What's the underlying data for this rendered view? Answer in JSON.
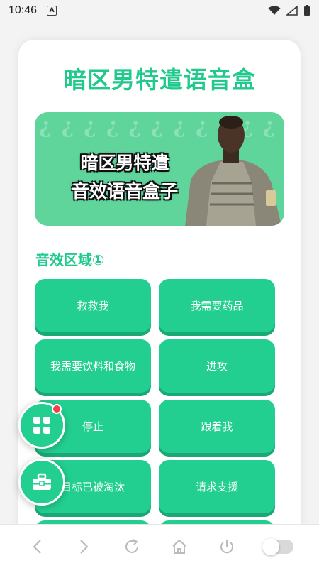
{
  "status_bar": {
    "time": "10:46",
    "notification_letter": "A"
  },
  "app": {
    "title": "暗区男特遣语音盒"
  },
  "banner": {
    "line1": "暗区男特遣",
    "line2": "音效语音盒子",
    "pattern_glyph": "¿"
  },
  "section": {
    "title": "音效区域①"
  },
  "sounds": [
    {
      "label": "救救我"
    },
    {
      "label": "我需要药品"
    },
    {
      "label": "我需要饮料和食物"
    },
    {
      "label": "进攻"
    },
    {
      "label": "停止"
    },
    {
      "label": "跟着我"
    },
    {
      "label": "目标已被淘汰"
    },
    {
      "label": "请求支援"
    },
    {
      "label": ""
    },
    {
      "label": ""
    }
  ],
  "colors": {
    "accent": "#22cf91",
    "title": "#22c98d",
    "badge": "#f0404a"
  },
  "icons": [
    "grid-icon",
    "toolbox-icon",
    "back-icon",
    "forward-icon",
    "refresh-icon",
    "home-icon",
    "power-icon"
  ]
}
